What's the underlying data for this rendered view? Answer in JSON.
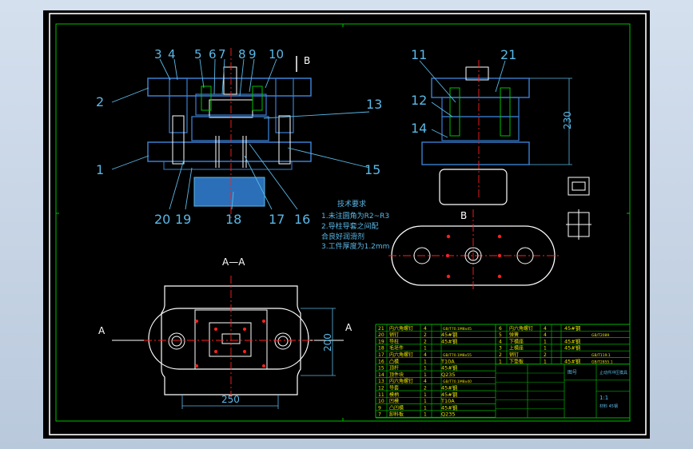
{
  "colors": {
    "background": "#000000",
    "frame": "#ffffff",
    "border_green": "#00c000",
    "dim_cyan": "#5ab8e6",
    "center_red": "#ff2020",
    "hatch_blue": "#2a6fb8",
    "table_green": "#00b400",
    "text_yellow": "#e6e600"
  },
  "balloons": {
    "top": [
      "3",
      "4",
      "5",
      "6",
      "7",
      "8",
      "9",
      "10"
    ],
    "left": [
      "2",
      "1"
    ],
    "bottom": [
      "20",
      "19",
      "18",
      "17",
      "16"
    ],
    "right": [
      "13",
      "15"
    ],
    "side": [
      "11",
      "21",
      "12",
      "14"
    ]
  },
  "view_labels": {
    "b_top": "B",
    "b_view": "B",
    "section": "A—A",
    "a_left": "A",
    "a_right": "A"
  },
  "dimensions": {
    "height_side": "230",
    "width_plan": "250",
    "height_plan": "200"
  },
  "tech_req": {
    "title": "技术要求",
    "lines": [
      "1.未注圆角为R2~R3",
      "2.导柱导套之间配",
      "合良好润滑剂",
      "3.工件厚度为1.2mm"
    ]
  },
  "parts_table": {
    "rows_left": [
      {
        "no": "21",
        "name": "内六角螺钉",
        "qty": "4",
        "mat": "",
        "std": "GB/T70.1M8x45"
      },
      {
        "no": "20",
        "name": "销钉",
        "qty": "2",
        "mat": "45#钢",
        "std": ""
      },
      {
        "no": "19",
        "name": "导柱",
        "qty": "2",
        "mat": "45#钢",
        "std": ""
      },
      {
        "no": "18",
        "name": "毛坯件",
        "qty": "1",
        "mat": "",
        "std": ""
      },
      {
        "no": "17",
        "name": "内六角螺钉",
        "qty": "4",
        "mat": "",
        "std": "GB/T70.1M8x55"
      },
      {
        "no": "16",
        "name": "凸模",
        "qty": "1",
        "mat": "T10A",
        "std": ""
      },
      {
        "no": "15",
        "name": "顶杆",
        "qty": "1",
        "mat": "45#钢",
        "std": ""
      },
      {
        "no": "14",
        "name": "顶件块",
        "qty": "1",
        "mat": "Q235",
        "std": ""
      },
      {
        "no": "13",
        "name": "内六角螺钉",
        "qty": "4",
        "mat": "",
        "std": "GB/T70.1M8x40"
      },
      {
        "no": "12",
        "name": "导套",
        "qty": "2",
        "mat": "45#钢",
        "std": ""
      },
      {
        "no": "11",
        "name": "模柄",
        "qty": "1",
        "mat": "45#钢",
        "std": ""
      },
      {
        "no": "10",
        "name": "凹模",
        "qty": "1",
        "mat": "T10A",
        "std": ""
      },
      {
        "no": "9",
        "name": "凸凹模",
        "qty": "1",
        "mat": "45#钢",
        "std": ""
      },
      {
        "no": "7",
        "name": "卸料板",
        "qty": "1",
        "mat": "Q235",
        "std": ""
      }
    ],
    "rows_right": [
      {
        "no": "6",
        "name": "内六角螺钉",
        "qty": "4",
        "mat": "45#钢",
        "std": ""
      },
      {
        "no": "5",
        "name": "弹簧",
        "qty": "4",
        "mat": "",
        "std": "GB/T2089"
      },
      {
        "no": "4",
        "name": "下模座",
        "qty": "1",
        "mat": "45#钢",
        "std": ""
      },
      {
        "no": "3",
        "name": "上模座",
        "qty": "1",
        "mat": "45#钢",
        "std": ""
      },
      {
        "no": "2",
        "name": "销钉",
        "qty": "2",
        "mat": "",
        "std": "GB/T119.1"
      },
      {
        "no": "1",
        "name": "下垫板",
        "qty": "1",
        "mat": "45#钢",
        "std": "GB/T2855.1"
      }
    ],
    "title_block": {
      "drawing_name": "止动件冲压模具",
      "scale": "1:1",
      "sheet": "图号",
      "note": "材料 45钢"
    }
  }
}
